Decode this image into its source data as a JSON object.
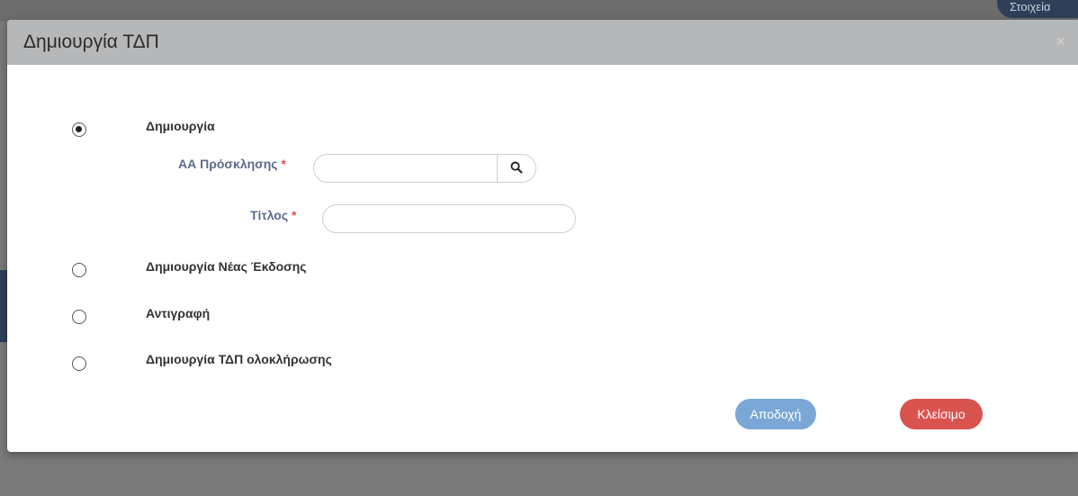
{
  "background": {
    "pill_text": "Στοιχεία"
  },
  "modal": {
    "title": "Δημιουργία ΤΔΠ",
    "close_glyph": "×"
  },
  "options": [
    {
      "label": "Δημιουργία",
      "checked": true
    },
    {
      "label": "Δημιουργία Νέας Έκδοσης",
      "checked": false
    },
    {
      "label": "Αντιγραφή",
      "checked": false
    },
    {
      "label": "Δημιουργία ΤΔΠ ολοκλήρωσης",
      "checked": false
    }
  ],
  "form": {
    "aa_label": "ΑΑ Πρόσκλησης",
    "aa_value": "",
    "title_label": "Τίτλος",
    "title_value": "",
    "required_mark": "*"
  },
  "buttons": {
    "accept": "Αποδοχή",
    "close": "Κλείσιμο"
  },
  "colors": {
    "header_bg": "#b6b7b8",
    "accept_bg": "#7ba7d6",
    "close_bg": "#d9534f",
    "field_label": "#5a6b8c"
  }
}
